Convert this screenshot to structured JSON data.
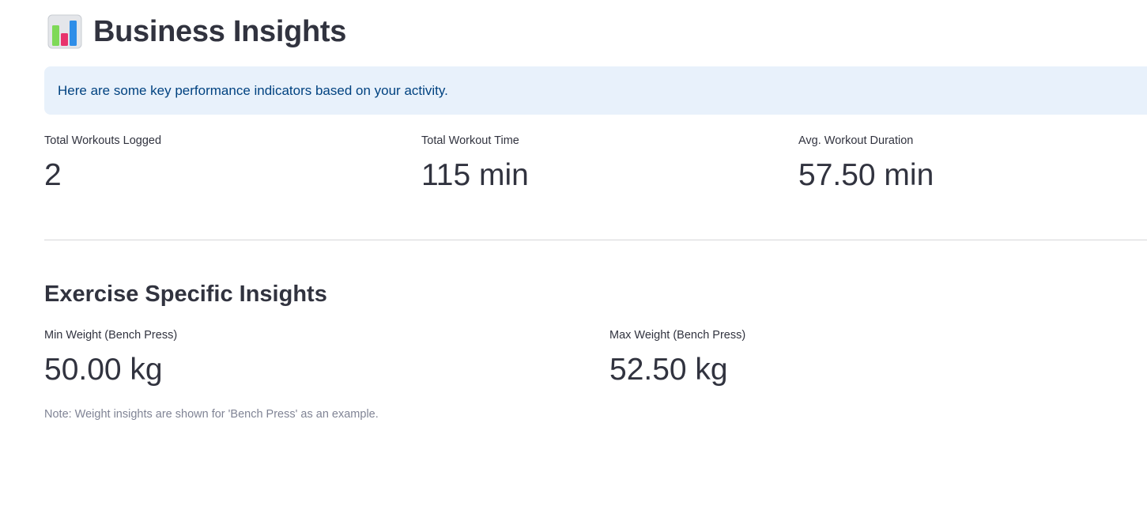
{
  "header": {
    "icon": "bar-chart-icon",
    "title": "Business Insights"
  },
  "info": {
    "text": "Here are some key performance indicators based on your activity."
  },
  "kpis": [
    {
      "label": "Total Workouts Logged",
      "value": "2"
    },
    {
      "label": "Total Workout Time",
      "value": "115 min"
    },
    {
      "label": "Avg. Workout Duration",
      "value": "57.50 min"
    }
  ],
  "exercise": {
    "title": "Exercise Specific Insights",
    "metrics": [
      {
        "label": "Min Weight (Bench Press)",
        "value": "50.00 kg"
      },
      {
        "label": "Max Weight (Bench Press)",
        "value": "52.50 kg"
      }
    ],
    "note": "Note: Weight insights are shown for 'Bench Press' as an example."
  },
  "colors": {
    "text": "#31333f",
    "info_bg": "#e8f1fb",
    "info_text": "#004280",
    "note_text": "#808495",
    "divider": "#d6d6d9"
  }
}
